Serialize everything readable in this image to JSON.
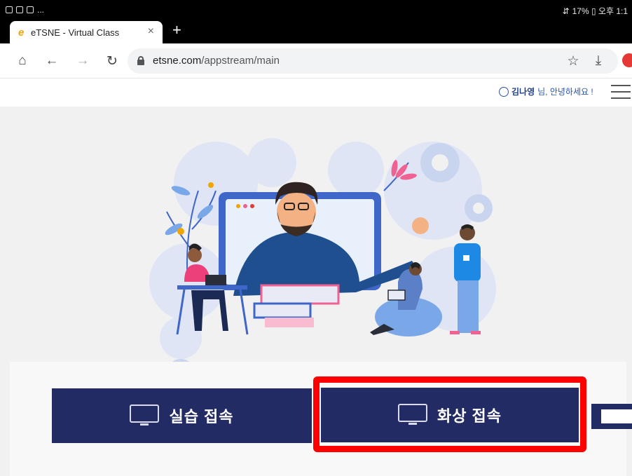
{
  "status_bar": {
    "left_extra": "...",
    "right_text": "17% ▯ 오후 1:1"
  },
  "tab": {
    "favicon": "e",
    "title": "eTSNE - Virtual Class",
    "close": "×",
    "new_tab": "+"
  },
  "toolbar": {
    "home_icon": "⌂",
    "back_icon": "←",
    "forward_icon": "→",
    "reload_icon": "↻",
    "url_domain": "etsne.com",
    "url_path": "/appstream/main",
    "star_icon": "☆",
    "download_icon": "⤓"
  },
  "header": {
    "user_name": "김나영",
    "greeting_suffix": " 님, 안녕하세요 !"
  },
  "buttons": {
    "practice_label": "실습 접속",
    "video_label": "화상 접속"
  },
  "colors": {
    "button_bg": "#222b63",
    "highlight": "#ff0000",
    "greeting": "#2a56a8"
  }
}
